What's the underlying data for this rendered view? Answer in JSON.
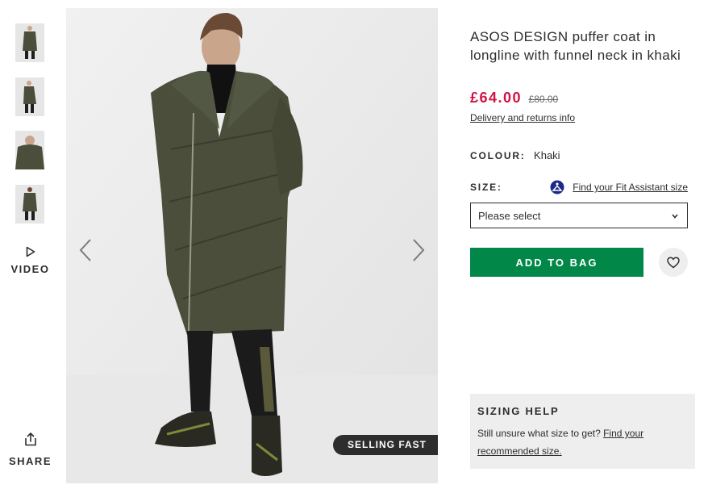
{
  "gallery": {
    "thumbnails": [
      {
        "alt": "thumbnail-front"
      },
      {
        "alt": "thumbnail-side"
      },
      {
        "alt": "thumbnail-closeup"
      },
      {
        "alt": "thumbnail-back"
      }
    ],
    "video_label": "VIDEO",
    "share_label": "SHARE",
    "badge": "SELLING FAST"
  },
  "product": {
    "title": "ASOS DESIGN puffer coat in longline with funnel neck in khaki",
    "price_now": "£64.00",
    "price_was": "£80.00",
    "delivery_link": "Delivery and returns info",
    "colour_label": "COLOUR:",
    "colour_value": "Khaki",
    "size_label": "SIZE:",
    "fit_assistant_link": "Find your Fit Assistant size",
    "size_select_value": "Please select",
    "add_to_bag_label": "ADD TO BAG"
  },
  "sizing_help": {
    "heading": "SIZING HELP",
    "text": "Still unsure what size to get?",
    "link_line1": "Find your",
    "link_line2": "recommended size."
  },
  "colors": {
    "price": "#d01345",
    "add_to_bag": "#018849",
    "coat": "#4a4e3a",
    "text": "#2d2d2d"
  }
}
